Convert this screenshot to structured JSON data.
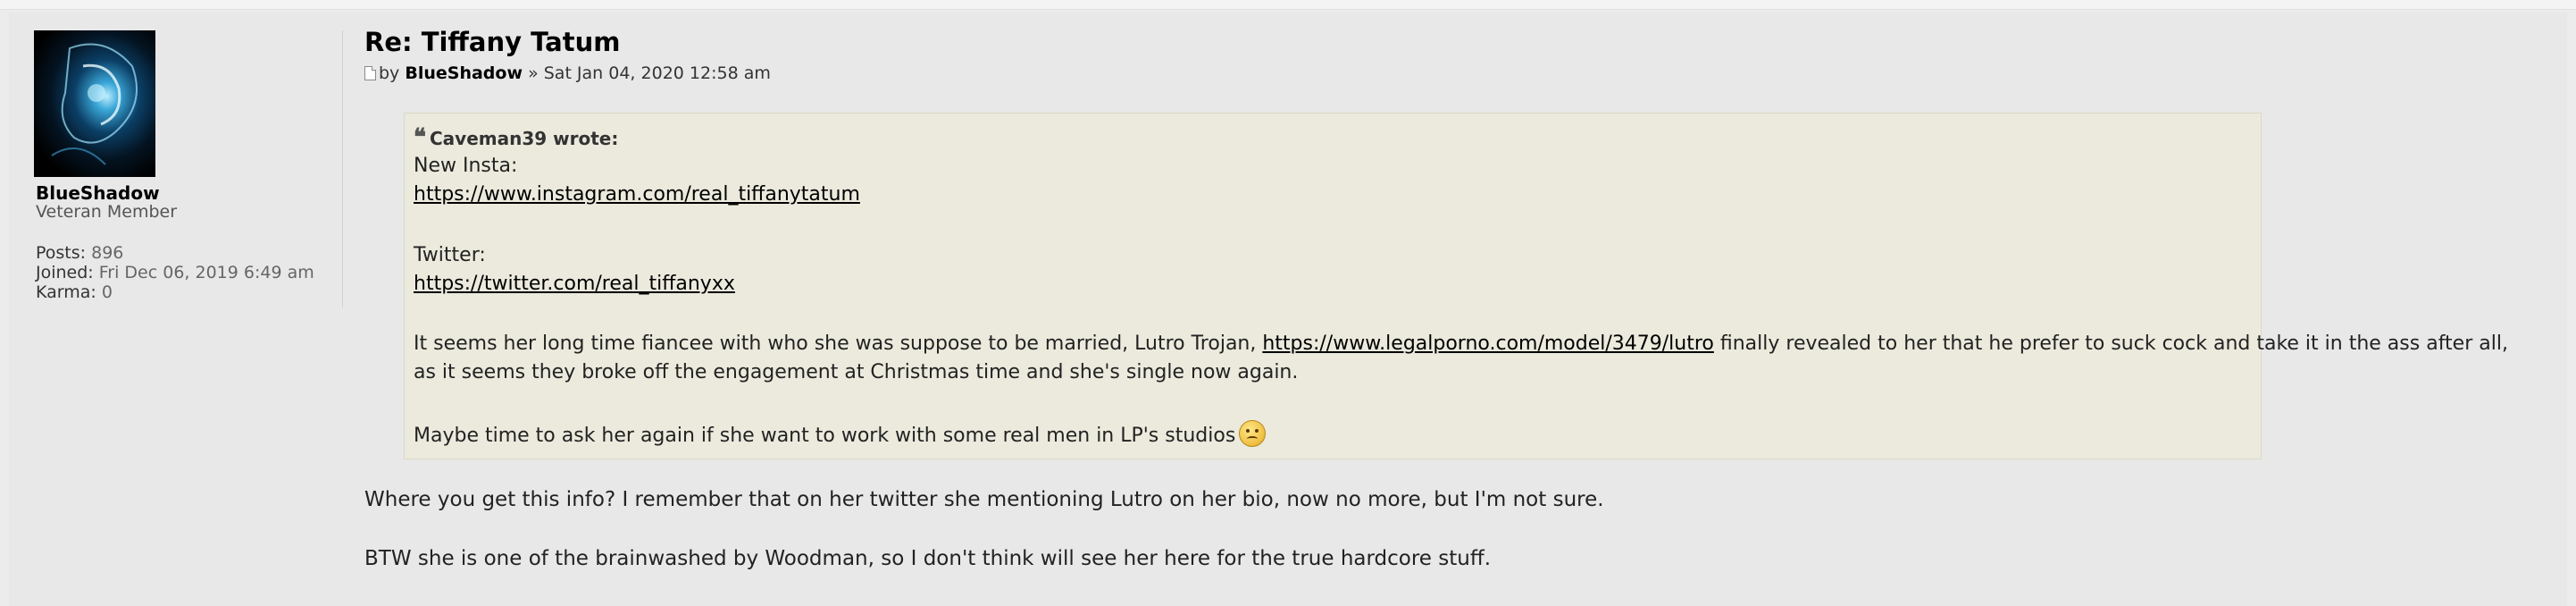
{
  "post": {
    "title": "Re: Tiffany Tatum",
    "meta_by": "by",
    "author": "BlueShadow",
    "meta_sep": "»",
    "date": "Sat Jan 04, 2020 12:58 am"
  },
  "profile": {
    "username": "BlueShadow",
    "rank": "Veteran Member",
    "posts_label": "Posts:",
    "posts_value": "896",
    "joined_label": "Joined:",
    "joined_value": "Fri Dec 06, 2019 6:49 am",
    "karma_label": "Karma:",
    "karma_value": "0"
  },
  "quote": {
    "icon": "quote-icon",
    "author_wrote": "Caveman39 wrote:",
    "line1": "New Insta:",
    "link1": "https://www.instagram.com/real_tiffanytatum",
    "line2": "Twitter:",
    "link2": "https://twitter.com/real_tiffanyxx",
    "para_a": "It seems her long time fiancee with who she was suppose to be married, Lutro Trojan, ",
    "link3": "https://www.legalporno.com/model/3479/lutro",
    "para_b": " finally revealed to her that he prefer to suck cock and take it in the ass after all,",
    "para_c": "as it seems they broke off the engagement at Christmas time and she's single now again.",
    "last": "Maybe time to ask her again if she want to work with some real men in LP's studios",
    "smiley": "smiley-icon"
  },
  "reply": {
    "line1": "Where you get this info? I remember that on her twitter she mentioning Lutro on her bio, now no more, but I'm not sure.",
    "line2": "BTW she is one of the brainwashed by Woodman, so I don't think will see her here for the true hardcore stuff."
  }
}
